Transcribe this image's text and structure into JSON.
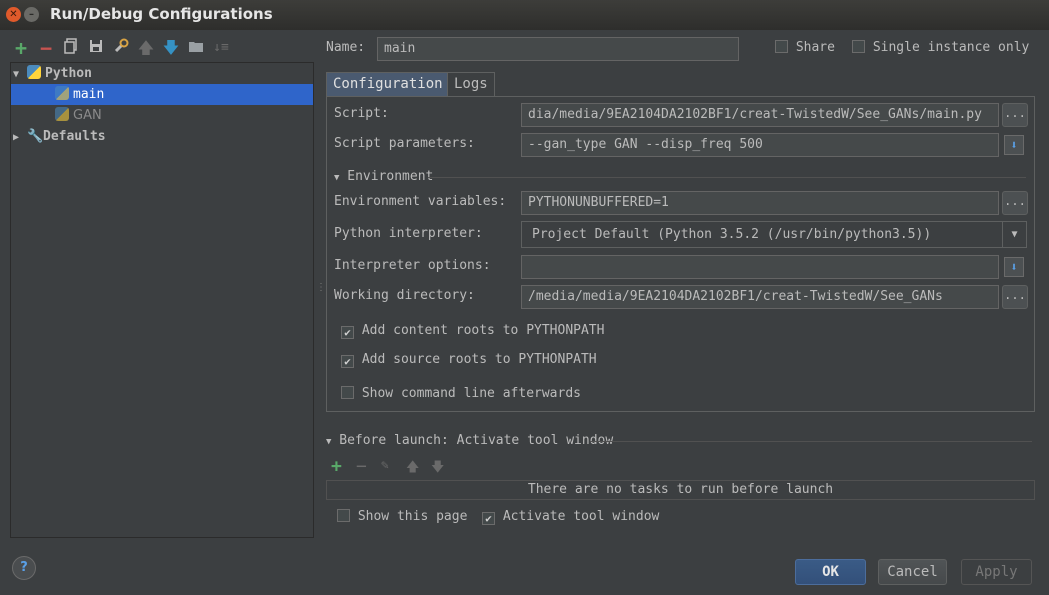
{
  "window": {
    "title": "Run/Debug Configurations"
  },
  "tree_toolbar": {
    "icons": [
      "add-icon",
      "remove-icon",
      "copy-icon",
      "save-icon",
      "wrench-icon",
      "move-up-icon",
      "move-down-icon",
      "folder-icon",
      "sort-icon"
    ]
  },
  "tree": {
    "python_label": "Python",
    "main_label": "main",
    "gan_label": "GAN",
    "defaults_label": "Defaults"
  },
  "header": {
    "name_label": "Name:",
    "name_value": "main",
    "share_label": "Share",
    "single_instance_label": "Single instance only"
  },
  "tabs": {
    "configuration": "Configuration",
    "logs": "Logs"
  },
  "config": {
    "script_label": "Script:",
    "script_value": "dia/media/9EA2104DA2102BF1/creat-TwistedW/See_GANs/main.py",
    "script_params_label": "Script parameters:",
    "script_params_value": "--gan_type GAN --disp_freq 500",
    "environment_header": "Environment",
    "env_vars_label": "Environment variables:",
    "env_vars_value": "PYTHONUNBUFFERED=1",
    "interpreter_label": "Python interpreter:",
    "interpreter_value": "Project Default (Python 3.5.2 (/usr/bin/python3.5))",
    "interpreter_options_label": "Interpreter options:",
    "interpreter_options_value": "",
    "working_dir_label": "Working directory:",
    "working_dir_value": "/media/media/9EA2104DA2102BF1/creat-TwistedW/See_GANs",
    "add_content_roots_label": "Add content roots to PYTHONPATH",
    "add_source_roots_label": "Add source roots to PYTHONPATH",
    "show_cmdline_label": "Show command line afterwards",
    "dots": "..."
  },
  "before_launch": {
    "header": "Before launch: Activate tool window",
    "empty_text": "There are no tasks to run before launch",
    "show_page_label": "Show this page",
    "activate_tool_label": "Activate tool window"
  },
  "buttons": {
    "ok": "OK",
    "cancel": "Cancel",
    "apply": "Apply",
    "help": "?"
  },
  "colors": {
    "accent": "#2f65ca",
    "background": "#3c3f41",
    "add_green": "#59a869",
    "remove_red": "#c75450",
    "arrow_blue": "#3592c4"
  }
}
